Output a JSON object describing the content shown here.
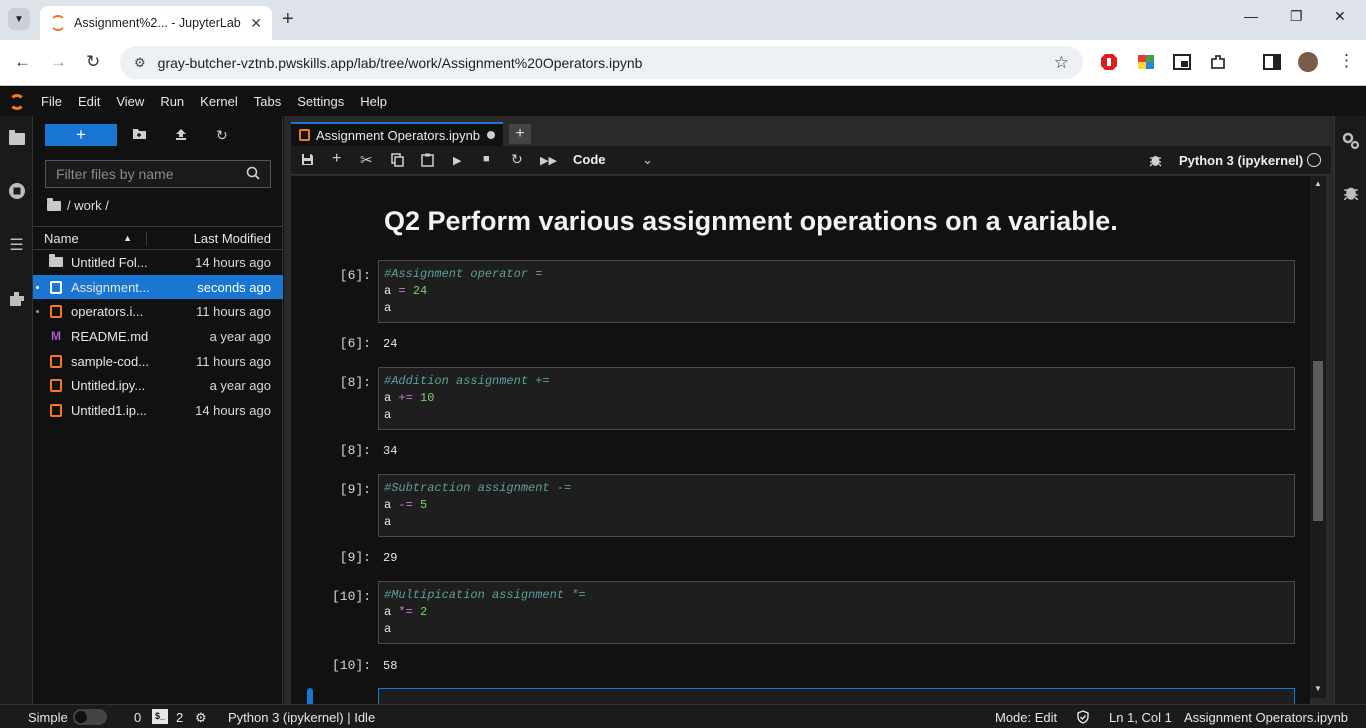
{
  "browser": {
    "tab_title": "Assignment%2... - JupyterLab",
    "url": "gray-butcher-vztnb.pwskills.app/lab/tree/work/Assignment%20Operators.ipynb"
  },
  "menubar": {
    "items": [
      "File",
      "Edit",
      "View",
      "Run",
      "Kernel",
      "Tabs",
      "Settings",
      "Help"
    ]
  },
  "filebrowser": {
    "filter_placeholder": "Filter files by name",
    "breadcrumb": "/ work /",
    "col_name": "Name",
    "col_modified": "Last Modified",
    "files": [
      {
        "name": "Untitled Fol...",
        "modified": "14 hours ago",
        "type": "folder"
      },
      {
        "name": "Assignment...",
        "modified": "seconds ago",
        "type": "notebook"
      },
      {
        "name": "operators.i...",
        "modified": "11 hours ago",
        "type": "notebook"
      },
      {
        "name": "README.md",
        "modified": "a year ago",
        "type": "markdown"
      },
      {
        "name": "sample-cod...",
        "modified": "11 hours ago",
        "type": "notebook"
      },
      {
        "name": "Untitled.ipy...",
        "modified": "a year ago",
        "type": "notebook"
      },
      {
        "name": "Untitled1.ip...",
        "modified": "14 hours ago",
        "type": "notebook"
      }
    ]
  },
  "notebook": {
    "tab_title": "Assignment Operators.ipynb",
    "cell_type": "Code",
    "kernel": "Python 3 (ipykernel)",
    "heading": "Q2 Perform various assignment operations on a variable.",
    "cells": [
      {
        "in_prompt": "[6]:",
        "comment": "#Assignment operator =",
        "op": "=",
        "num": "24",
        "out_prompt": "[6]:",
        "output": "24"
      },
      {
        "in_prompt": "[8]:",
        "comment": "#Addition assignment +=",
        "op": "+=",
        "num": "10",
        "out_prompt": "[8]:",
        "output": "34"
      },
      {
        "in_prompt": "[9]:",
        "comment": "#Subtraction assignment -=",
        "op": "-=",
        "num": "5",
        "out_prompt": "[9]:",
        "output": "29"
      },
      {
        "in_prompt": "[10]:",
        "comment": "#Multipication assignment *=",
        "op": "*=",
        "num": "2",
        "out_prompt": "[10]:",
        "output": "58"
      }
    ],
    "var": "a"
  },
  "statusbar": {
    "mode_label": "Simple",
    "terminals": "0",
    "kernels": "2",
    "kernel_status": "Python 3 (ipykernel) | Idle",
    "edit_mode": "Mode: Edit",
    "cursor": "Ln 1, Col 1",
    "file": "Assignment Operators.ipynb"
  },
  "icons": {
    "folder": "folder-icon",
    "notebook": "notebook-icon",
    "markdown": "markdown-icon"
  },
  "colors": {
    "accent": "#1976d2",
    "jupyter_orange": "#f37726",
    "comment": "#5f9e9a",
    "operator": "#c678dd",
    "number": "#7fcf6f"
  }
}
